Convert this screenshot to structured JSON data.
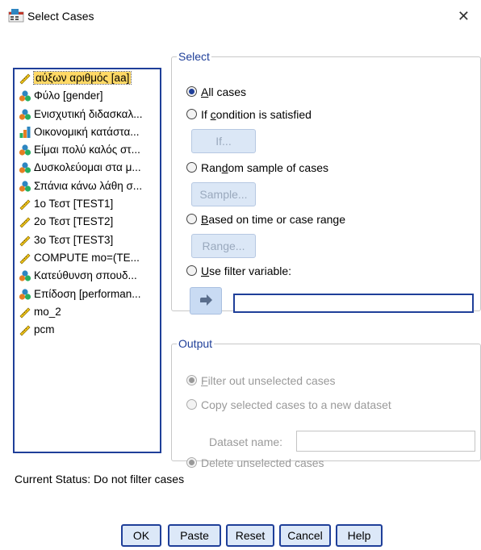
{
  "window": {
    "title": "Select Cases"
  },
  "variables": [
    {
      "label": "αύξων αριθμός [aa]",
      "icon": "ruler-icon",
      "selected": true
    },
    {
      "label": "Φύλο [gender]",
      "icon": "nominal-icon"
    },
    {
      "label": "Ενισχυτική διδασκαλ...",
      "icon": "nominal-icon"
    },
    {
      "label": "Οικονομική κατάστα...",
      "icon": "ordinal-icon"
    },
    {
      "label": "Είμαι πολύ καλός στ...",
      "icon": "nominal-icon"
    },
    {
      "label": "Δυσκολεύομαι στα μ...",
      "icon": "nominal-icon"
    },
    {
      "label": "Σπάνια κάνω λάθη σ...",
      "icon": "nominal-icon"
    },
    {
      "label": "1ο Τεστ [TEST1]",
      "icon": "ruler-icon"
    },
    {
      "label": "2ο Τεστ [TEST2]",
      "icon": "ruler-icon"
    },
    {
      "label": "3ο Τεστ [TEST3]",
      "icon": "ruler-icon"
    },
    {
      "label": "COMPUTE mo=(TE...",
      "icon": "ruler-icon"
    },
    {
      "label": "Κατεύθυνση σπουδ...",
      "icon": "nominal-icon"
    },
    {
      "label": "Επίδοση [performan...",
      "icon": "nominal-icon"
    },
    {
      "label": "mo_2",
      "icon": "ruler-icon"
    },
    {
      "label": "pcm",
      "icon": "ruler-icon"
    }
  ],
  "select": {
    "legend": "Select",
    "all_cases": {
      "pre": "",
      "key": "A",
      "post": "ll cases"
    },
    "if_condition": {
      "pre": "If ",
      "key": "c",
      "post": "ondition is satisfied"
    },
    "if_button": "If...",
    "random": {
      "pre": "Ran",
      "key": "d",
      "post": "om sample of cases"
    },
    "sample_button": "Sample...",
    "time_range": {
      "pre": "",
      "key": "B",
      "post": "ased on time or case range"
    },
    "range_button": "Range...",
    "filter_var": {
      "pre": "",
      "key": "U",
      "post": "se filter variable:"
    },
    "selected_option": "all_cases"
  },
  "output": {
    "legend": "Output",
    "filter_out": "Filter out unselected cases",
    "copy_selected": "Copy selected cases to a new dataset",
    "dataset_name_label": "Dataset name:",
    "delete_unselected": "Delete unselected cases"
  },
  "status": "Current Status: Do not filter cases",
  "buttons": {
    "ok": "OK",
    "paste": "Paste",
    "reset": "Reset",
    "cancel": "Cancel",
    "help": "Help"
  },
  "colors": {
    "accent": "#1f3f99",
    "selection": "#ffd966",
    "button_bg": "#dce8f8"
  }
}
